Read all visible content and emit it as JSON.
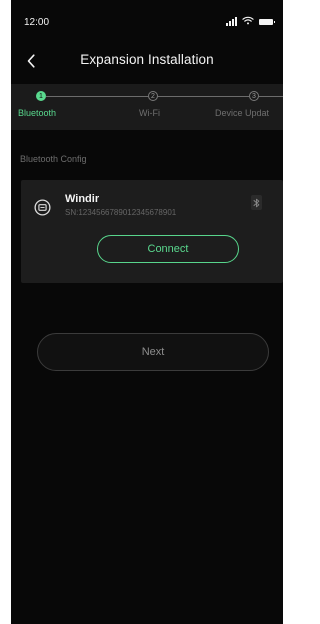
{
  "status_bar": {
    "time": "12:00",
    "signal_icon": "signal-icon",
    "wifi_icon": "wifi-icon",
    "battery_icon": "battery-icon"
  },
  "header": {
    "title": "Expansion Installation",
    "back_icon": "chevron-left-icon"
  },
  "stepper": {
    "steps": [
      {
        "number": "1",
        "label": "Bluetooth"
      },
      {
        "number": "2",
        "label": "Wi-Fi"
      },
      {
        "number": "3",
        "label": "Device Updat"
      }
    ],
    "active_step": 1,
    "active_color": "#59d98e"
  },
  "bluetooth_config": {
    "section_label": "Bluetooth Config",
    "device": {
      "icon": "device-icon",
      "name": "Windir",
      "serial": "SN:12345667890123456789​01",
      "bluetooth_icon": "bluetooth-icon"
    },
    "connect_label": "Connect"
  },
  "footer": {
    "next_label": "Next"
  }
}
